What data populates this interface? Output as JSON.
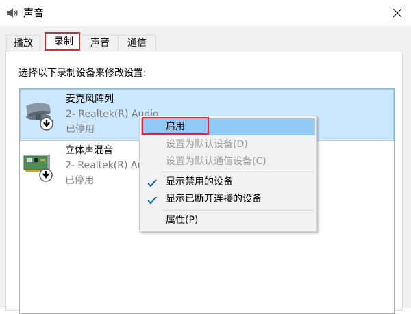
{
  "window": {
    "title": "声音",
    "close_icon": "close-icon"
  },
  "tabs": [
    {
      "label": "播放",
      "selected": false
    },
    {
      "label": "录制",
      "selected": true
    },
    {
      "label": "声音",
      "selected": false
    },
    {
      "label": "通信",
      "selected": false
    }
  ],
  "instruction": "选择以下录制设备来修改设置:",
  "devices": [
    {
      "name": "麦克风阵列",
      "driver": "2- Realtek(R) Audio",
      "status": "已停用",
      "icon": "microphone-array-icon",
      "selected": true
    },
    {
      "name": "立体声混音",
      "driver": "2- Realtek(R) Audio",
      "status": "已停用",
      "icon": "sound-card-icon",
      "selected": false
    }
  ],
  "context_menu": {
    "items": [
      {
        "label": "启用",
        "enabled": true,
        "checked": false,
        "hover": true
      },
      {
        "label": "设置为默认设备(D)",
        "enabled": false,
        "checked": false
      },
      {
        "label": "设置为默认通信设备(C)",
        "enabled": false,
        "checked": false
      },
      {
        "label": "显示禁用的设备",
        "enabled": true,
        "checked": true
      },
      {
        "label": "显示已断开连接的设备",
        "enabled": true,
        "checked": true
      },
      {
        "label": "属性(P)",
        "enabled": true,
        "checked": false
      }
    ]
  },
  "colors": {
    "highlight": "#e0262f",
    "selection": "#cce8ff",
    "menu_hover": "#91c9f7",
    "check": "#0063b1"
  }
}
